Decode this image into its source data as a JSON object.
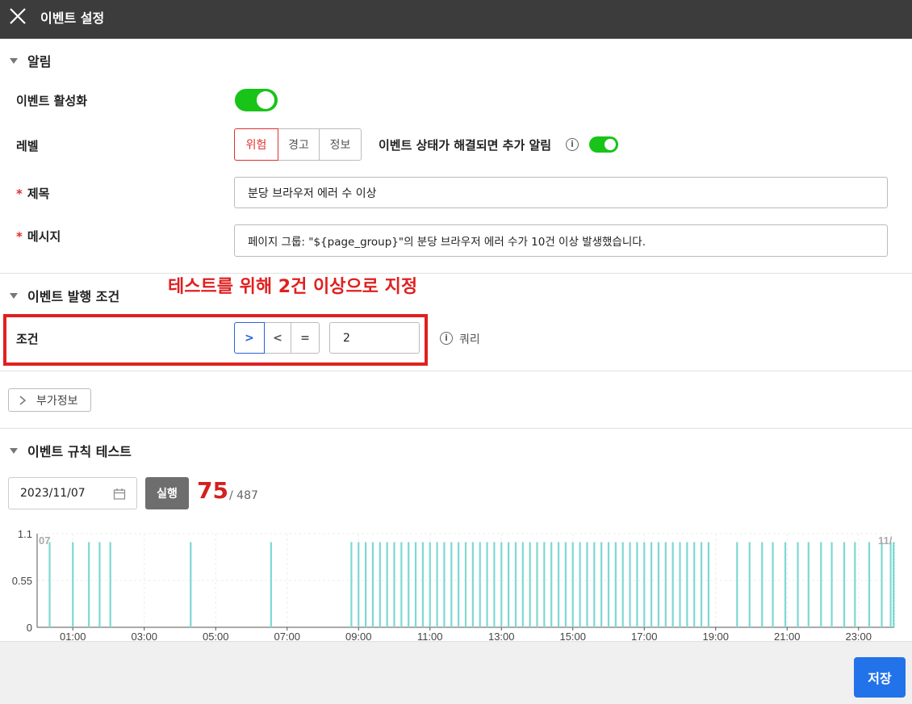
{
  "window": {
    "title": "이벤트 설정"
  },
  "alarm": {
    "section_title": "알림",
    "enable_label": "이벤트 활성화",
    "enabled": true,
    "level_label": "레벨",
    "levels": [
      "위험",
      "경고",
      "정보"
    ],
    "selected_level": "위험",
    "resolve_label": "이벤트 상태가 해결되면 추가 알림",
    "resolve_enabled": true,
    "title_label": "제목",
    "title_value": "분당 브라우저 에러 수 이상",
    "message_label": "메시지",
    "message_value": "페이지 그룹: \"${page_group}\"의 분당 브라우저 에러 수가 10건 이상 발생했습니다.",
    "required_mark": "*"
  },
  "condition": {
    "section_title": "이벤트 발행 조건",
    "annotation": "테스트를 위해 2건 이상으로 지정",
    "label": "조건",
    "operators": [
      ">",
      "<",
      "="
    ],
    "selected_operator": ">",
    "value": "2",
    "query_label": "쿼리"
  },
  "extra": {
    "label": "부가정보"
  },
  "test": {
    "section_title": "이벤트 규칙 테스트",
    "date": "2023/11/07",
    "run_label": "실행",
    "matched": "75",
    "separator": "/",
    "total": "487"
  },
  "chart_data": {
    "type": "bar",
    "y_ticks": [
      "1.1",
      "0.55",
      "0"
    ],
    "ylim": [
      0,
      1.1
    ],
    "x_ticks": [
      "01:00",
      "03:00",
      "05:00",
      "07:00",
      "09:00",
      "11:00",
      "13:00",
      "15:00",
      "17:00",
      "19:00",
      "21:00",
      "23:00"
    ],
    "corner_left": "07",
    "corner_right": "11/",
    "bar_value": 1,
    "series_color": "#7dd8d2",
    "event_times_hours": [
      0.35,
      1.0,
      1.45,
      1.75,
      2.05,
      4.3,
      6.55,
      8.8,
      9.0,
      9.2,
      9.4,
      9.6,
      9.8,
      10.0,
      10.2,
      10.4,
      10.6,
      10.8,
      11.0,
      11.2,
      11.4,
      11.6,
      11.8,
      12.0,
      12.2,
      12.4,
      12.6,
      12.8,
      13.0,
      13.2,
      13.4,
      13.6,
      13.8,
      14.0,
      14.2,
      14.4,
      14.6,
      14.8,
      15.0,
      15.2,
      15.4,
      15.6,
      15.8,
      16.0,
      16.2,
      16.4,
      16.6,
      16.8,
      17.0,
      17.2,
      17.4,
      17.6,
      17.8,
      18.0,
      18.2,
      18.4,
      18.6,
      18.8,
      19.6,
      19.95,
      20.3,
      20.6,
      20.95,
      21.3,
      21.6,
      21.95,
      22.25,
      22.6,
      22.9,
      23.3,
      23.65,
      23.9,
      23.98
    ]
  },
  "footer": {
    "save_label": "저장"
  }
}
